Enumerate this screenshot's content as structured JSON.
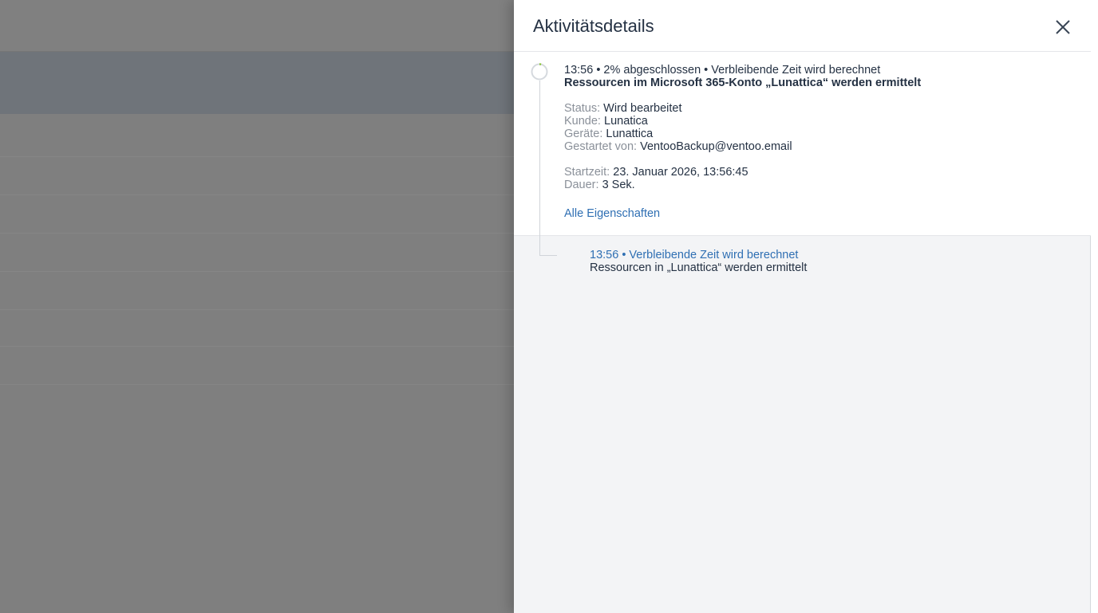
{
  "panel": {
    "title": "Aktivitätsdetails",
    "accent_color": "#2f6fb3",
    "progress_color": "#8dc63f",
    "progress_fraction": 0.02
  },
  "activity": {
    "meta": "13:56 • 2% abgeschlossen • Verbleibende Zeit wird berechnet",
    "title": "Ressourcen im Microsoft 365-Konto „Lunattica“ werden ermittelt",
    "status_label": "Status:",
    "status_value": "Wird bearbeitet",
    "customer_label": "Kunde:",
    "customer_value": "Lunatica",
    "devices_label": "Geräte:",
    "devices_value": "Lunattica",
    "started_by_label": "Gestartet von:",
    "started_by_value": "VentooBackup@ventoo.email",
    "start_time_label": "Startzeit:",
    "start_time_value": "23. Januar 2026, 13:56:45",
    "duration_label": "Dauer:",
    "duration_value": "3 Sek.",
    "all_properties_link": "Alle Eigenschaften"
  },
  "subactivity": {
    "meta": "13:56 • Verbleibende Zeit wird berechnet",
    "title": "Ressourcen in „Lunattica“ werden ermittelt"
  }
}
